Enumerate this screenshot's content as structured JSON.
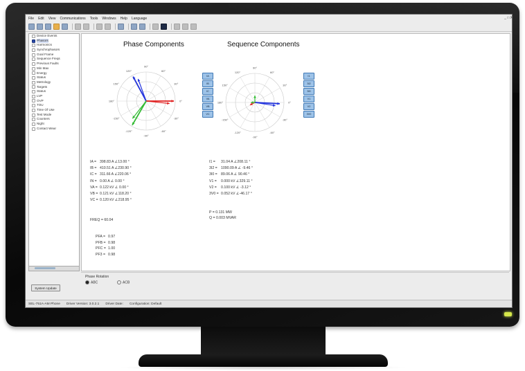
{
  "menu": {
    "items": [
      "File",
      "Edit",
      "View",
      "Communications",
      "Tools",
      "Windows",
      "Help",
      "Language"
    ],
    "window_controls": "_ □ X"
  },
  "tree": {
    "items": [
      "Device Events",
      "Phasors",
      "Harmonics",
      "Synchrophasors",
      "Goal Frame",
      "Sequence Freqs",
      "Previous Faults",
      "Min Max",
      "Energy",
      "Status",
      "Metrology",
      "Targets",
      "Status",
      "LVP",
      "OVP",
      "TOU",
      "Time Of Use",
      "Test Mode",
      "Counters",
      "Night",
      "Contact Wear"
    ],
    "selected_index": 1,
    "scroll_label": ""
  },
  "buttons": {
    "update": "System Update"
  },
  "phase": {
    "title": "Phase Components",
    "rows": [
      {
        "label": "IA =",
        "value": "398.83 A  ∠13.00 °"
      },
      {
        "label": "IB =",
        "value": "410.51 A  ∠230.90 °"
      },
      {
        "label": "IC =",
        "value": "311.66 A  ∠220.06 °"
      },
      {
        "label": "IN =",
        "value": "0.00 A  ∠   0.00 °"
      },
      {
        "label": "VA =",
        "value": "0.122 kV  ∠   0.00 °"
      },
      {
        "label": "VB =",
        "value": "0.121 kV  ∠118.20 °"
      },
      {
        "label": "VC =",
        "value": "0.120 kV  ∠218.95 °"
      }
    ],
    "freq": "FREQ = 60.04",
    "pf_rows": [
      {
        "label": "PFA =",
        "value": "0.97"
      },
      {
        "label": "PFB =",
        "value": "0.98"
      },
      {
        "label": "PFC =",
        "value": "1.00"
      },
      {
        "label": "PF3 =",
        "value": "0.98"
      }
    ],
    "side_buttons": [
      "IA",
      "IB",
      "IC",
      "VA",
      "VB",
      "VC"
    ],
    "angle_labels": [
      "0°",
      "30°",
      "60°",
      "90°",
      "120°",
      "150°",
      "180°",
      "-150°",
      "-120°",
      "-90°",
      "-60°",
      "-30°"
    ]
  },
  "sequence": {
    "title": "Sequence Components",
    "rows": [
      {
        "label": "I1 =",
        "value": "31.04 A  ∠208.11 °"
      },
      {
        "label": "3I2 =",
        "value": "1090.09 A  ∠  -9.46 °"
      },
      {
        "label": "3I0 =",
        "value": "89.06 A  ∠ 90.46 °"
      },
      {
        "label": "V1 =",
        "value": "0.000 kV  ∠329.11 °"
      },
      {
        "label": "V2 =",
        "value": "0.100 kV  ∠  -3.12 °"
      },
      {
        "label": "3V0 =",
        "value": "0.052 kV  ∠-46.17 °"
      }
    ],
    "power": {
      "p": "P =  0.131 MW",
      "q": "Q = 0.003 MVAR"
    },
    "side_buttons": [
      "I1",
      "3I2",
      "3I0",
      "V1",
      "V2",
      "3V0"
    ],
    "angle_labels": [
      "0°",
      "30°",
      "60°",
      "90°",
      "120°",
      "150°",
      "180°",
      "-150°",
      "-120°",
      "-90°",
      "-60°",
      "-30°"
    ]
  },
  "phase_rotation": {
    "title": "Phase Rotation",
    "options": [
      "ABC",
      "ACB"
    ],
    "selected": "ABC"
  },
  "status": {
    "items": [
      "SEL-751A-AM Phone",
      "Driver Version: 3.0.2.1",
      "Driver Date:",
      "Configuration: Default"
    ]
  },
  "colors": {
    "phase_a": "#e02020",
    "phase_b": "#2233dd",
    "phase_c": "#33bb33",
    "button_fill": "#9ec3e8",
    "button_border": "#3e78b5"
  }
}
